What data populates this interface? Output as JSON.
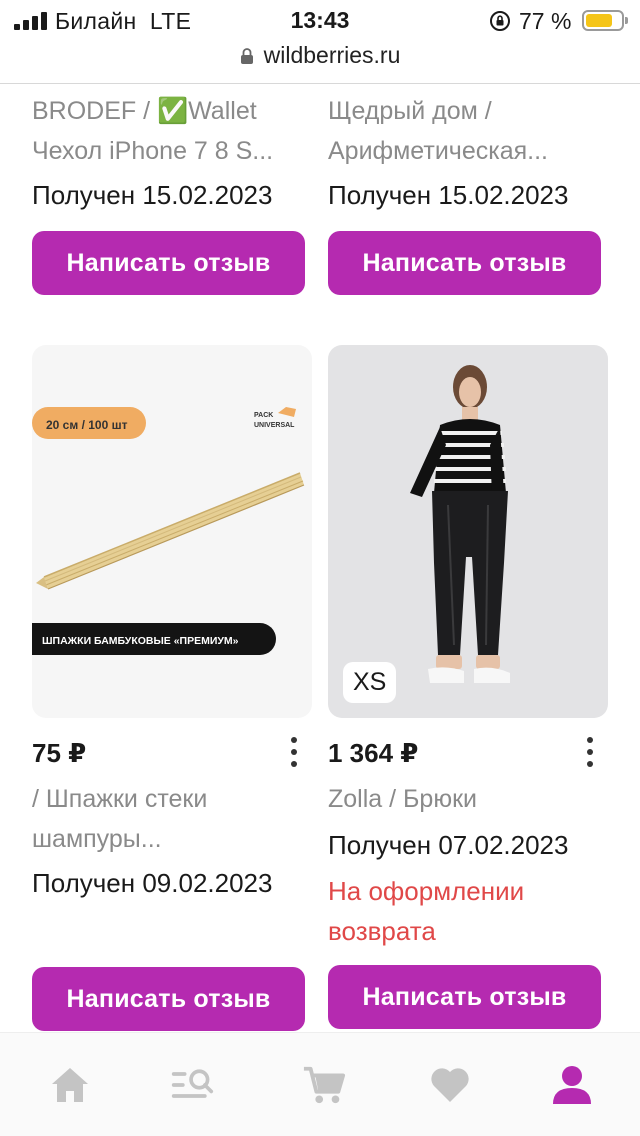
{
  "status_bar": {
    "carrier": "Билайн  LTE",
    "time": "13:43",
    "battery_percent": "77 %",
    "battery_level": 0.77,
    "signal_bars": 4
  },
  "browser": {
    "url": "wildberries.ru"
  },
  "products": [
    {
      "subtitle_lines": [
        "BRODEF / ✅Wallet",
        "Чехол iPhone 7 8 S..."
      ],
      "received": "Получен 15.02.2023",
      "review_button": "Написать отзыв"
    },
    {
      "subtitle_lines": [
        "Щедрый дом /",
        "Арифметическая..."
      ],
      "received": "Получен 15.02.2023",
      "review_button": "Написать отзыв"
    },
    {
      "price": "75 ₽",
      "image_texts": {
        "tag": "20 см / 100 шт",
        "brand_line1": "PACK",
        "brand_line2": "UNIVERSAL",
        "banner": "ШПАЖКИ БАМБУКОВЫЕ «ПРЕМИУМ»"
      },
      "subtitle_lines": [
        "/ Шпажки стеки",
        "шампуры..."
      ],
      "received": "Получен 09.02.2023",
      "review_button": "Написать отзыв"
    },
    {
      "price": "1 364 ₽",
      "size_badge": "XS",
      "subtitle_lines": [
        "Zolla / Брюки"
      ],
      "received": "Получен 07.02.2023",
      "return_status_lines": [
        "На оформлении",
        "возврата"
      ],
      "review_button": "Написать отзыв"
    }
  ],
  "bottom_nav": {
    "items": [
      "home-icon",
      "catalog-search-icon",
      "cart-icon",
      "heart-icon",
      "profile-icon"
    ],
    "active_color": "#b52ab0",
    "inactive_color": "#c4c4c4"
  },
  "colors": {
    "accent": "#b52ab0",
    "return_status": "#e04848",
    "muted_text": "#8a8a8a"
  }
}
